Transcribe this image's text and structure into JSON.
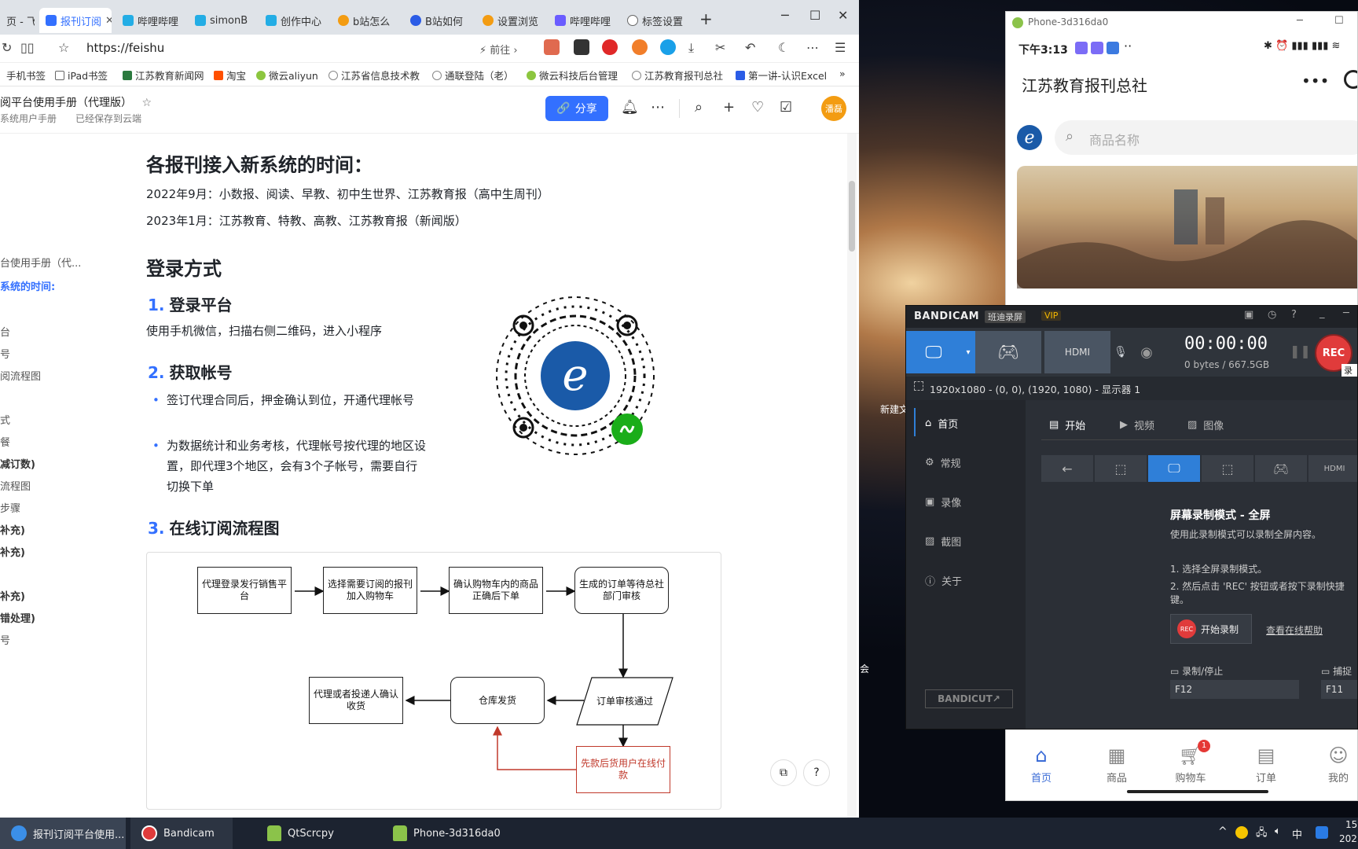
{
  "browser": {
    "tabs": [
      {
        "label": "页 - 飞"
      },
      {
        "label": "报刊订阅",
        "active": true
      },
      {
        "label": "哔哩哔哩"
      },
      {
        "label": "simonB"
      },
      {
        "label": "创作中心"
      },
      {
        "label": "b站怎么"
      },
      {
        "label": "B站如何"
      },
      {
        "label": "设置浏览"
      },
      {
        "label": "哔哩哔哩"
      },
      {
        "label": "标签设置"
      }
    ],
    "new_tab": "+",
    "url": "https://feishu",
    "forward_label": "前往",
    "bookmarks": [
      "手机书签",
      "iPad书签",
      "江苏教育新闻网",
      "淘宝",
      "微云aliyun",
      "江苏省信息技术教",
      "通联登陆（老）",
      "微云科技后台管理",
      "江苏教育报刊总社",
      "第一讲-认识Excel"
    ],
    "doc_title": "阅平台使用手册（代理版）",
    "doc_sub1": "系统用户手册",
    "doc_sub2": "已经保存到云端",
    "share": "分享",
    "avatar": "潘磊"
  },
  "outline": [
    {
      "text": "台使用手册（代...",
      "style": "b"
    },
    {
      "text": "系统的时间:",
      "style": "act"
    },
    {
      "text": "台",
      "style": ""
    },
    {
      "text": "号",
      "style": ""
    },
    {
      "text": "阅流程图",
      "style": ""
    },
    {
      "text": "式",
      "style": ""
    },
    {
      "text": "餐",
      "style": ""
    },
    {
      "text": "减订数)",
      "style": "b"
    },
    {
      "text": "流程图",
      "style": ""
    },
    {
      "text": "步骤",
      "style": ""
    },
    {
      "text": "补充)",
      "style": "b"
    },
    {
      "text": "补充)",
      "style": "b"
    },
    {
      "text": "补充)",
      "style": "b"
    },
    {
      "text": "错处理)",
      "style": "b"
    },
    {
      "text": "号",
      "style": ""
    }
  ],
  "content": {
    "h_time": "各报刊接入新系统的时间：",
    "time1": "2022年9月：小数报、阅读、早教、初中生世界、江苏教育报（高中生周刊）",
    "time2": "2023年1月：江苏教育、特教、高教、江苏教育报（新闻版）",
    "h_login": "登录方式",
    "s1_num": "1.",
    "s1": "登录平台",
    "s1_text": "使用手机微信，扫描右侧二维码，进入小程序",
    "s2_num": "2.",
    "s2": "获取帐号",
    "b1": "签订代理合同后，押金确认到位，开通代理帐号",
    "b2": "为数据统计和业务考核，代理帐号按代理的地区设置，即代理3个地区，会有3个子帐号，需要自行切换下单",
    "s3_num": "3.",
    "s3": "在线订阅流程图"
  },
  "flow": {
    "n1": "代理登录发行销售平台",
    "n2": "选择需要订阅的报刊加入购物车",
    "n3": "确认购物车内的商品正确后下单",
    "n4": "生成的订单等待总社部门审核",
    "n5": "订单审核通过",
    "n6": "仓库发货",
    "n7": "代理或者投递人确认收货",
    "n8": "先款后货用户在线付款"
  },
  "phone": {
    "window_title": "Phone-3d316da0",
    "time": "下午3:13",
    "app_title": "江苏教育报刊总社",
    "search_placeholder": "商品名称",
    "nav": [
      {
        "label": "首页",
        "icon": "home-icon",
        "active": true
      },
      {
        "label": "商品",
        "icon": "grid-icon"
      },
      {
        "label": "购物车",
        "icon": "cart-icon",
        "badge": "1"
      },
      {
        "label": "订单",
        "icon": "order-icon"
      },
      {
        "label": "我的",
        "icon": "user-icon"
      }
    ]
  },
  "bandicam": {
    "brand": "BANDICAM",
    "tag1": "班迪录屏",
    "tag2": "VIP",
    "timer": "00:00:00",
    "size": "0 bytes / 667.5GB",
    "rec": "REC",
    "rec_tooltip": "录制",
    "area_info": "1920x1080 - (0, 0), (1920, 1080) - 显示器 1",
    "side": [
      "首页",
      "常规",
      "录像",
      "截图",
      "关于"
    ],
    "tabs": [
      "开始",
      "视频",
      "图像"
    ],
    "mode_title": "屏幕录制模式 - 全屏",
    "mode_desc": "使用此录制模式可以录制全屏内容。",
    "step1": "1. 选择全屏录制模式。",
    "step2": "2. 然后点击 'REC' 按钮或者按下录制快捷键。",
    "start_btn": "开始录制",
    "help_link": "查看在线帮助",
    "hk1_label": "录制/停止",
    "hk1": "F12",
    "hk2_label": "捕捉图像",
    "hk2": "F11",
    "bandicut": "BANDICUT"
  },
  "desktop": {
    "icon_label": "新建文",
    "side_text": "会"
  },
  "taskbar": {
    "items": [
      "报刊订阅平台使用...",
      "Bandicam",
      "QtScrcpy",
      "Phone-3d316da0"
    ],
    "ime": "中",
    "clock": "15",
    "date": "202"
  }
}
